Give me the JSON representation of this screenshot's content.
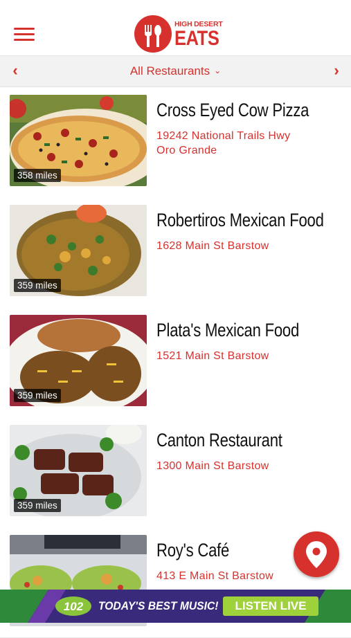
{
  "header": {
    "menu_icon": "hamburger-menu-icon",
    "logo_small": "HIGH DESERT",
    "logo_big": "EATS",
    "accent": "#d6312c"
  },
  "filter": {
    "label": "All Restaurants",
    "prev_icon": "chevron-left-icon",
    "next_icon": "chevron-right-icon",
    "dropdown_icon": "chevron-down-icon"
  },
  "restaurants": [
    {
      "name": "Cross Eyed Cow Pizza",
      "address_line1": "19242 National Trails Hwy",
      "address_line2": "Oro Grande",
      "distance": "358 miles",
      "image": "pizza"
    },
    {
      "name": "Robertiros Mexican Food",
      "address_line1": "1628 Main St Barstow",
      "address_line2": "",
      "distance": "359 miles",
      "image": "burrito"
    },
    {
      "name": "Plata's Mexican Food",
      "address_line1": "1521 Main St Barstow",
      "address_line2": "",
      "distance": "359 miles",
      "image": "enchiladas"
    },
    {
      "name": "Canton Restaurant",
      "address_line1": "1300 Main St Barstow",
      "address_line2": "",
      "distance": "359 miles",
      "image": "ribs"
    },
    {
      "name": "Roy's Café",
      "address_line1": "413 E Main St Barstow",
      "address_line2": "",
      "distance": "",
      "image": "salad"
    }
  ],
  "map_button": {
    "icon": "map-pin-icon"
  },
  "banner": {
    "station": "102",
    "tagline": "TODAY'S BEST MUSIC!",
    "cta": "LISTEN LIVE"
  }
}
